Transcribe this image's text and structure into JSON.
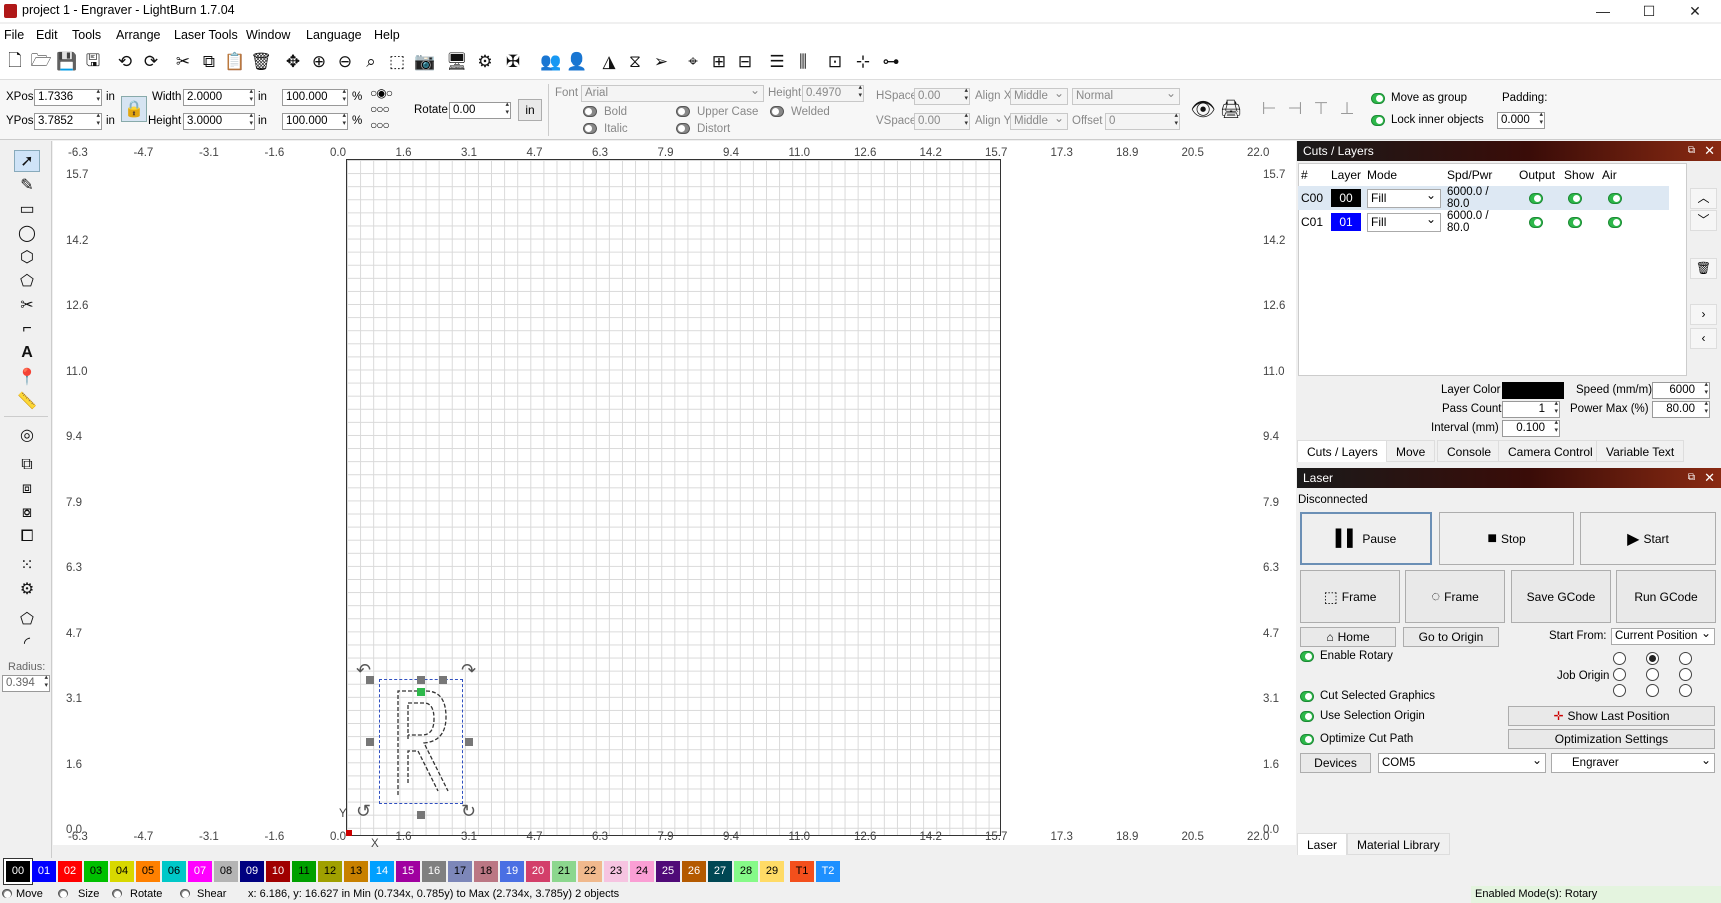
{
  "window": {
    "title": "project 1 - Engraver - LightBurn 1.7.04",
    "min": "—",
    "max": "☐",
    "close": "✕"
  },
  "menu": [
    "File",
    "Edit",
    "Tools",
    "Arrange",
    "Laser Tools",
    "Window",
    "Language",
    "Help"
  ],
  "toolbar_icons": [
    "new-file-icon",
    "open-folder-icon",
    "save-icon",
    "save-as-icon",
    "undo-icon",
    "redo-icon",
    "cut-icon",
    "copy-icon",
    "paste-icon",
    "delete-icon",
    "move-icon",
    "zoom-in-icon",
    "zoom-out-icon",
    "zoom-fit-icon",
    "zoom-selection-icon",
    "camera-icon",
    "monitor-icon",
    "settings-icon",
    "tools-icon",
    "group-icon",
    "user-icon",
    "mirror-icon",
    "flip-icon",
    "send-icon",
    "target-icon",
    "align-icon",
    "measure-icon",
    "distribute-icon",
    "spacing-icon",
    "align-center-icon",
    "dock-icon"
  ],
  "transform": {
    "xpos_label": "XPos",
    "xpos": "1.7336",
    "ypos_label": "YPos",
    "ypos": "3.7852",
    "unit": "in",
    "width_label": "Width",
    "width": "2.0000",
    "height_label": "Height",
    "height": "3.0000",
    "scale_w": "100.000",
    "scale_h": "100.000",
    "percent": "%",
    "rotate_label": "Rotate",
    "rotate": "0.00",
    "in_button": "in"
  },
  "text_tools": {
    "font_label": "Font",
    "font": "Arial",
    "height_label": "Height",
    "height": "0.4970",
    "hspace_label": "HSpace",
    "hspace": "0.00",
    "vspace_label": "VSpace",
    "vspace": "0.00",
    "alignx_label": "Align X",
    "alignx": "Middle",
    "aligny_label": "Align Y",
    "aligny": "Middle",
    "style": "Normal",
    "offset_label": "Offset",
    "offset": "0",
    "bold": "Bold",
    "italic": "Italic",
    "upper": "Upper Case",
    "distort": "Distort",
    "welded": "Welded"
  },
  "group_opts": {
    "move_as_group": "Move as group",
    "lock_inner": "Lock inner objects",
    "padding_label": "Padding:",
    "padding": "0.000"
  },
  "left_tools": {
    "radius_label": "Radius:",
    "radius": "0.394"
  },
  "rulers": {
    "top": [
      "-6.3",
      "-4.7",
      "-3.1",
      "-1.6",
      "0.0",
      "1.6",
      "3.1",
      "4.7",
      "6.3",
      "7.9",
      "9.4",
      "11.0",
      "12.6",
      "14.2",
      "15.7",
      "17.3",
      "18.9",
      "20.5",
      "22.0"
    ],
    "left": [
      "15.7",
      "14.2",
      "12.6",
      "11.0",
      "9.4",
      "7.9",
      "6.3",
      "4.7",
      "3.1",
      "1.6",
      "0.0"
    ],
    "bottom": [
      "-6.3",
      "-4.7",
      "-3.1",
      "-1.6",
      "0.0",
      "1.6",
      "3.1",
      "4.7",
      "6.3",
      "7.9",
      "9.4",
      "11.0",
      "12.6",
      "14.2",
      "15.7",
      "17.3",
      "18.9",
      "20.5",
      "22.0"
    ],
    "axis_x": "X",
    "axis_y": "Y"
  },
  "canvas_object": {
    "letter": "R"
  },
  "cuts_panel": {
    "title": "Cuts / Layers",
    "columns": [
      "#",
      "Layer",
      "Mode",
      "Spd/Pwr",
      "Output",
      "Show",
      "Air"
    ],
    "rows": [
      {
        "id": "C00",
        "layer": "00",
        "color": "#000000",
        "mode": "Fill",
        "spdpwr": "6000.0 / 80.0"
      },
      {
        "id": "C01",
        "layer": "01",
        "color": "#0000ff",
        "mode": "Fill",
        "spdpwr": "6000.0 / 80.0"
      }
    ],
    "layer_color_label": "Layer Color",
    "speed_label": "Speed (mm/m)",
    "speed": "6000",
    "pass_count_label": "Pass Count",
    "pass_count": "1",
    "power_max_label": "Power Max (%)",
    "power_max": "80.00",
    "interval_label": "Interval (mm)",
    "interval": "0.100",
    "tabs": [
      "Cuts / Layers",
      "Move",
      "Console",
      "Camera Control",
      "Variable Text"
    ]
  },
  "laser_panel": {
    "title": "Laser",
    "status": "Disconnected",
    "pause": "Pause",
    "stop": "Stop",
    "start": "Start",
    "frame1": "Frame",
    "frame2": "Frame",
    "save_gcode": "Save GCode",
    "run_gcode": "Run GCode",
    "home": "Home",
    "go_origin": "Go to Origin",
    "start_from_label": "Start From:",
    "start_from": "Current Position",
    "enable_rotary": "Enable Rotary",
    "job_origin_label": "Job Origin",
    "cut_selected": "Cut Selected Graphics",
    "use_selection_origin": "Use Selection Origin",
    "optimize_cut": "Optimize Cut Path",
    "show_last": "Show Last Position",
    "optimization_settings": "Optimization Settings",
    "devices": "Devices",
    "port": "COM5",
    "device": "Engraver",
    "tabs": [
      "Laser",
      "Material Library"
    ]
  },
  "palette": [
    {
      "label": "00",
      "color": "#000000",
      "fg": "#ffffff"
    },
    {
      "label": "01",
      "color": "#0000ff",
      "fg": "#ffffff"
    },
    {
      "label": "02",
      "color": "#ff0000",
      "fg": "#ffffff"
    },
    {
      "label": "03",
      "color": "#00c000",
      "fg": "#000000"
    },
    {
      "label": "04",
      "color": "#d8d800",
      "fg": "#000000"
    },
    {
      "label": "05",
      "color": "#ff8000",
      "fg": "#000000"
    },
    {
      "label": "06",
      "color": "#00c8c8",
      "fg": "#000000"
    },
    {
      "label": "07",
      "color": "#ff00ff",
      "fg": "#ffffff"
    },
    {
      "label": "08",
      "color": "#b4b4b4",
      "fg": "#000000"
    },
    {
      "label": "09",
      "color": "#000080",
      "fg": "#ffffff"
    },
    {
      "label": "10",
      "color": "#a00000",
      "fg": "#ffffff"
    },
    {
      "label": "11",
      "color": "#00a000",
      "fg": "#000000"
    },
    {
      "label": "12",
      "color": "#a0a000",
      "fg": "#000000"
    },
    {
      "label": "13",
      "color": "#c88000",
      "fg": "#000000"
    },
    {
      "label": "14",
      "color": "#00a0ff",
      "fg": "#ffffff"
    },
    {
      "label": "15",
      "color": "#a000a0",
      "fg": "#ffffff"
    },
    {
      "label": "16",
      "color": "#808080",
      "fg": "#ffffff"
    },
    {
      "label": "17",
      "color": "#7d87b9",
      "fg": "#000000"
    },
    {
      "label": "18",
      "color": "#bb7784",
      "fg": "#000000"
    },
    {
      "label": "19",
      "color": "#4a6fe3",
      "fg": "#ffffff"
    },
    {
      "label": "20",
      "color": "#d33f6a",
      "fg": "#ffffff"
    },
    {
      "label": "21",
      "color": "#8cd78e",
      "fg": "#000000"
    },
    {
      "label": "22",
      "color": "#f0b98d",
      "fg": "#000000"
    },
    {
      "label": "23",
      "color": "#f6c4e1",
      "fg": "#000000"
    },
    {
      "label": "24",
      "color": "#fa9ed4",
      "fg": "#000000"
    },
    {
      "label": "25",
      "color": "#500a78",
      "fg": "#ffffff"
    },
    {
      "label": "26",
      "color": "#b45a00",
      "fg": "#ffffff"
    },
    {
      "label": "27",
      "color": "#004754",
      "fg": "#ffffff"
    },
    {
      "label": "28",
      "color": "#86fa88",
      "fg": "#000000"
    },
    {
      "label": "29",
      "color": "#ffdb66",
      "fg": "#000000"
    },
    {
      "label": "T1",
      "color": "#f34f1c",
      "fg": "#000000"
    },
    {
      "label": "T2",
      "color": "#1e90ff",
      "fg": "#ffffff"
    }
  ],
  "status": {
    "move": "Move",
    "size": "Size",
    "rotate": "Rotate",
    "shear": "Shear",
    "coords": "x: 6.186, y: 16.627 in   Min (0.734x, 0.785y) to Max (2.734x, 3.785y)  2 objects",
    "modes": "Enabled Mode(s): Rotary"
  }
}
